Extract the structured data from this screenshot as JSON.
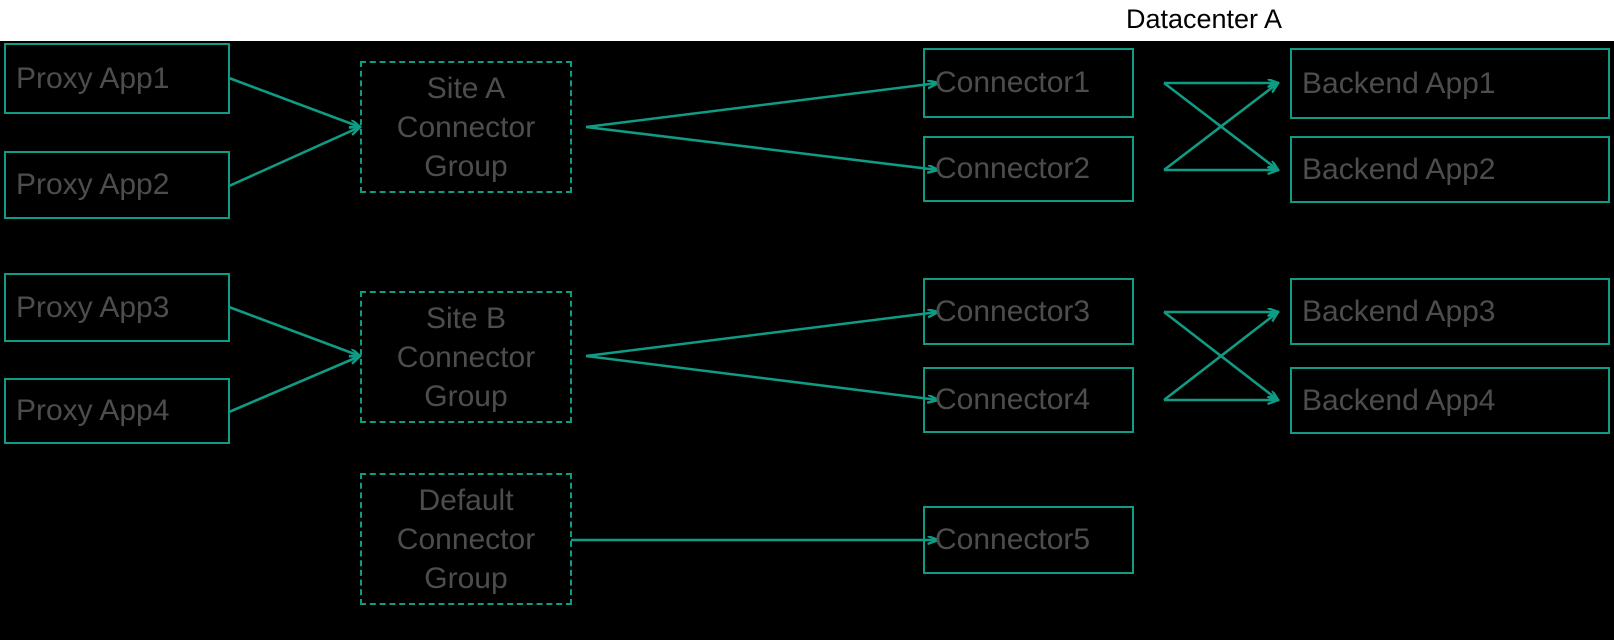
{
  "diagram": {
    "title": "Datacenter A",
    "accent_color": "#0f9b84",
    "node_text_color": "#4d4d4d",
    "title_color": "#000000",
    "background_color": "#000000",
    "header_band_color": "#ffffff",
    "proxy_apps": [
      {
        "label": "Proxy App1"
      },
      {
        "label": "Proxy App2"
      },
      {
        "label": "Proxy App3"
      },
      {
        "label": "Proxy App4"
      }
    ],
    "connector_groups": [
      {
        "label": "Site A\nConnector\nGroup",
        "line1": "Site A",
        "line2": "Connector",
        "line3": "Group"
      },
      {
        "label": "Site B\nConnector\nGroup",
        "line1": "Site B",
        "line2": "Connector",
        "line3": "Group"
      },
      {
        "label": "Default\nConnector\nGroup",
        "line1": "Default",
        "line2": "Connector",
        "line3": "Group"
      }
    ],
    "connectors": [
      {
        "label": "Connector1"
      },
      {
        "label": "Connector2"
      },
      {
        "label": "Connector3"
      },
      {
        "label": "Connector4"
      },
      {
        "label": "Connector5"
      }
    ],
    "backend_apps": [
      {
        "label": "Backend App1"
      },
      {
        "label": "Backend App2"
      },
      {
        "label": "Backend App3"
      },
      {
        "label": "Backend App4"
      }
    ]
  }
}
